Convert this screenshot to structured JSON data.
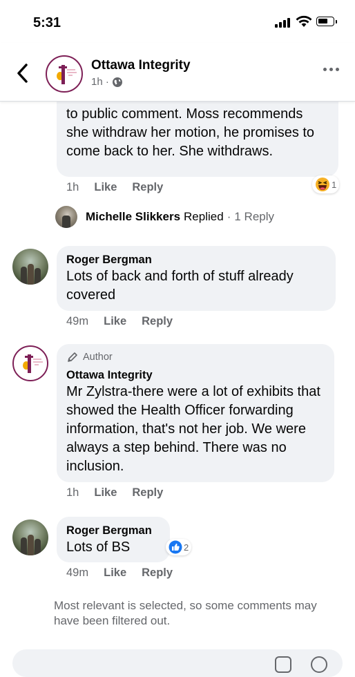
{
  "status_bar": {
    "time": "5:31",
    "battery_level": 0.7
  },
  "header": {
    "page_name": "Ottawa Integrity",
    "time": "1h ·",
    "icons": [
      "back-chevron-icon",
      "globe-icon",
      "more-options-icon"
    ]
  },
  "comments": [
    {
      "text": "to public comment. Moss recommends she withdraw her motion, he promises to come back to her. She withdraws.",
      "time": "1h",
      "like_label": "Like",
      "reply_label": "Reply",
      "reaction": {
        "icon": "haha-emoji-icon",
        "count": "1",
        "color": "#f7b125"
      }
    },
    {
      "author": "Roger Bergman",
      "text": "Lots of back and forth of stuff already covered",
      "time": "49m",
      "like_label": "Like",
      "reply_label": "Reply"
    },
    {
      "badge": "Author",
      "author": "Ottawa Integrity",
      "text": "Mr Zylstra-there were a lot of exhibits that showed the Health Officer forwarding information, that's not her job. We were always a step behind. There was no inclusion.",
      "time": "1h",
      "like_label": "Like",
      "reply_label": "Reply"
    },
    {
      "author": "Roger Bergman",
      "text": "Lots of BS",
      "time": "49m",
      "like_label": "Like",
      "reply_label": "Reply",
      "reaction": {
        "icon": "like-thumb-icon",
        "count": "2",
        "color": "#1877f2"
      }
    }
  ],
  "replied_row": {
    "name": "Michelle Slikkers",
    "action": "Replied",
    "separator": "·",
    "reply_count": "1 Reply"
  },
  "footer_note": "Most relevant is selected, so some comments may have been filtered out.",
  "colors": {
    "brand_maroon": "#7d1f56",
    "brand_gold": "#f2a900",
    "bubble_bg": "#f0f2f5",
    "secondary_text": "#65676b"
  }
}
